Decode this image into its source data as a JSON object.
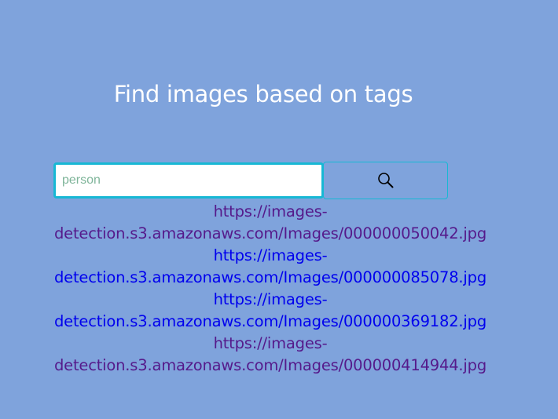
{
  "page": {
    "title": "Find images based on tags"
  },
  "search": {
    "value": "",
    "placeholder": "person",
    "button_icon": "search-icon"
  },
  "results": [
    {
      "line1": "https://images-",
      "line2": "detection.s3.amazonaws.com/Images/000000050042.jpg",
      "visited": true
    },
    {
      "line1": "https://images-",
      "line2": "detection.s3.amazonaws.com/Images/000000085078.jpg",
      "visited": false
    },
    {
      "line1": "https://images-",
      "line2": "detection.s3.amazonaws.com/Images/000000369182.jpg",
      "visited": false
    },
    {
      "line1": "https://images-",
      "line2": "detection.s3.amazonaws.com/Images/000000414944.jpg",
      "visited": true
    }
  ],
  "colors": {
    "background": "#7fa3dc",
    "link": "#0000ee",
    "visited_link": "#551a8b",
    "input_border": "#17b8d4"
  }
}
